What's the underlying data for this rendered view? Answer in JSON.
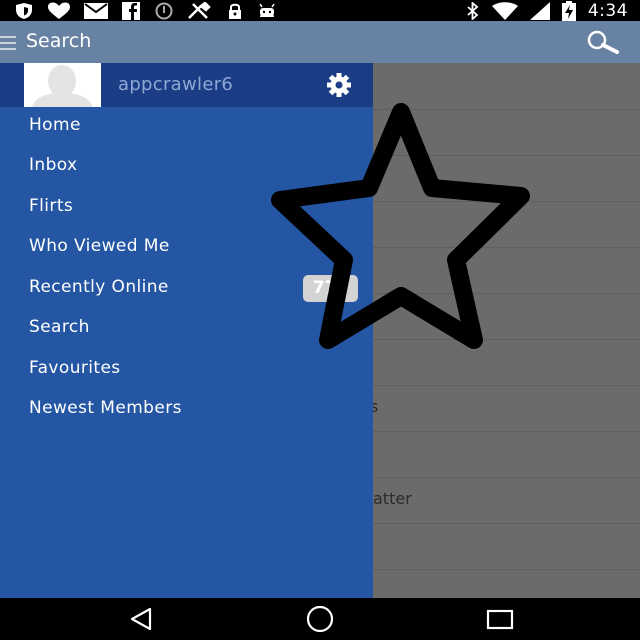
{
  "status_bar": {
    "time": "4:34",
    "left_icons": [
      "shield-icon",
      "heart-icon",
      "mail-icon",
      "facebook-icon",
      "data-saver-icon",
      "crossed-tools-icon",
      "lock-icon",
      "android-icon"
    ],
    "right_icons": [
      "bluetooth-icon",
      "wifi-icon",
      "signal-icon",
      "battery-charging-icon"
    ]
  },
  "app_bar": {
    "title": "Search",
    "icons": [
      "menu-icon",
      "search-icon"
    ]
  },
  "drawer": {
    "username": "appcrawler6",
    "items": [
      {
        "label": "Home"
      },
      {
        "label": "Inbox"
      },
      {
        "label": "Flirts"
      },
      {
        "label": "Who Viewed Me"
      },
      {
        "label": "Recently Online",
        "badge": "777"
      },
      {
        "label": "Search"
      },
      {
        "label": "Favourites"
      },
      {
        "label": "Newest Members"
      }
    ]
  },
  "background_content": {
    "visible_fragments": [
      "s",
      "s",
      "atter"
    ]
  },
  "overlay": {
    "icon": "star-outline-icon"
  },
  "nav_bar": {
    "icons": [
      "back-icon",
      "home-icon",
      "recents-icon"
    ]
  },
  "colors": {
    "drawer": "#2456a3",
    "drawer_header": "#1a3d85",
    "app_bar": "#6882a3",
    "dim_content": "#6b6b6b",
    "badge": "#d3d3d3"
  }
}
